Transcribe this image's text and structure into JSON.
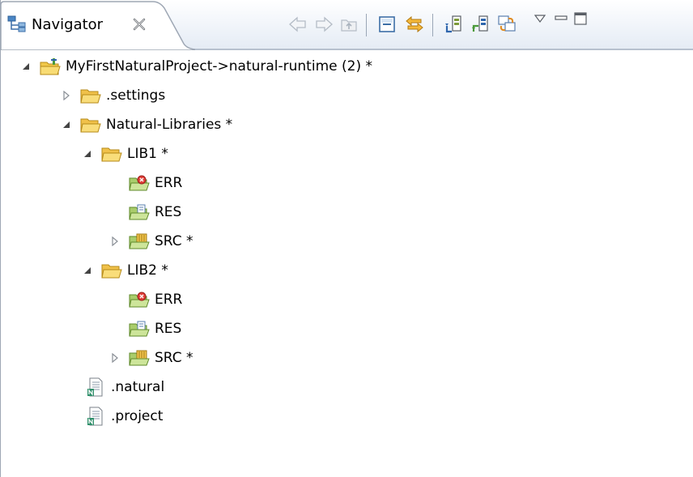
{
  "view": {
    "tab": {
      "title": "Navigator",
      "icon": "navigator-icon",
      "close_icon": "close-icon"
    },
    "toolbar": [
      {
        "name": "back-button",
        "icon": "back-arrow-icon",
        "enabled": false
      },
      {
        "name": "forward-button",
        "icon": "forward-arrow-icon",
        "enabled": false
      },
      {
        "name": "up-button",
        "icon": "up-folder-icon",
        "enabled": false
      },
      {
        "name": "collapse-all-button",
        "icon": "collapse-all-icon",
        "enabled": true
      },
      {
        "name": "link-with-editor-button",
        "icon": "link-editor-icon",
        "enabled": true
      },
      {
        "name": "download-button",
        "icon": "download-icon",
        "enabled": true
      },
      {
        "name": "upload-button",
        "icon": "upload-icon",
        "enabled": true
      },
      {
        "name": "refresh-button",
        "icon": "refresh-icon",
        "enabled": true
      },
      {
        "name": "view-menu-button",
        "icon": "view-menu-icon",
        "enabled": true
      },
      {
        "name": "minimize-button",
        "icon": "minimize-icon",
        "enabled": true
      },
      {
        "name": "maximize-button",
        "icon": "maximize-icon",
        "enabled": true
      }
    ]
  },
  "tree": [
    {
      "label": "MyFirstNaturalProject->natural-runtime (2) *",
      "level": 0,
      "twisty": "expanded",
      "icon": "project-icon"
    },
    {
      "label": ".settings",
      "level": 1,
      "twisty": "collapsed",
      "icon": "folder-icon"
    },
    {
      "label": "Natural-Libraries *",
      "level": 1,
      "twisty": "expanded",
      "icon": "folder-icon"
    },
    {
      "label": "LIB1 *",
      "level": 2,
      "twisty": "expanded",
      "icon": "folder-icon"
    },
    {
      "label": "ERR",
      "level": 3,
      "twisty": "none",
      "icon": "error-folder-icon"
    },
    {
      "label": "RES",
      "level": 3,
      "twisty": "none",
      "icon": "resource-folder-icon"
    },
    {
      "label": "SRC *",
      "level": 3,
      "twisty": "collapsed",
      "icon": "source-folder-icon"
    },
    {
      "label": "LIB2 *",
      "level": 2,
      "twisty": "expanded",
      "icon": "folder-icon"
    },
    {
      "label": "ERR",
      "level": 3,
      "twisty": "none",
      "icon": "error-folder-icon"
    },
    {
      "label": "RES",
      "level": 3,
      "twisty": "none",
      "icon": "resource-folder-icon"
    },
    {
      "label": "SRC *",
      "level": 3,
      "twisty": "collapsed",
      "icon": "source-folder-icon"
    },
    {
      "label": ".natural",
      "level": 2,
      "twisty": "none",
      "icon": "natural-file-icon"
    },
    {
      "label": ".project",
      "level": 2,
      "twisty": "none",
      "icon": "natural-file-icon"
    }
  ]
}
